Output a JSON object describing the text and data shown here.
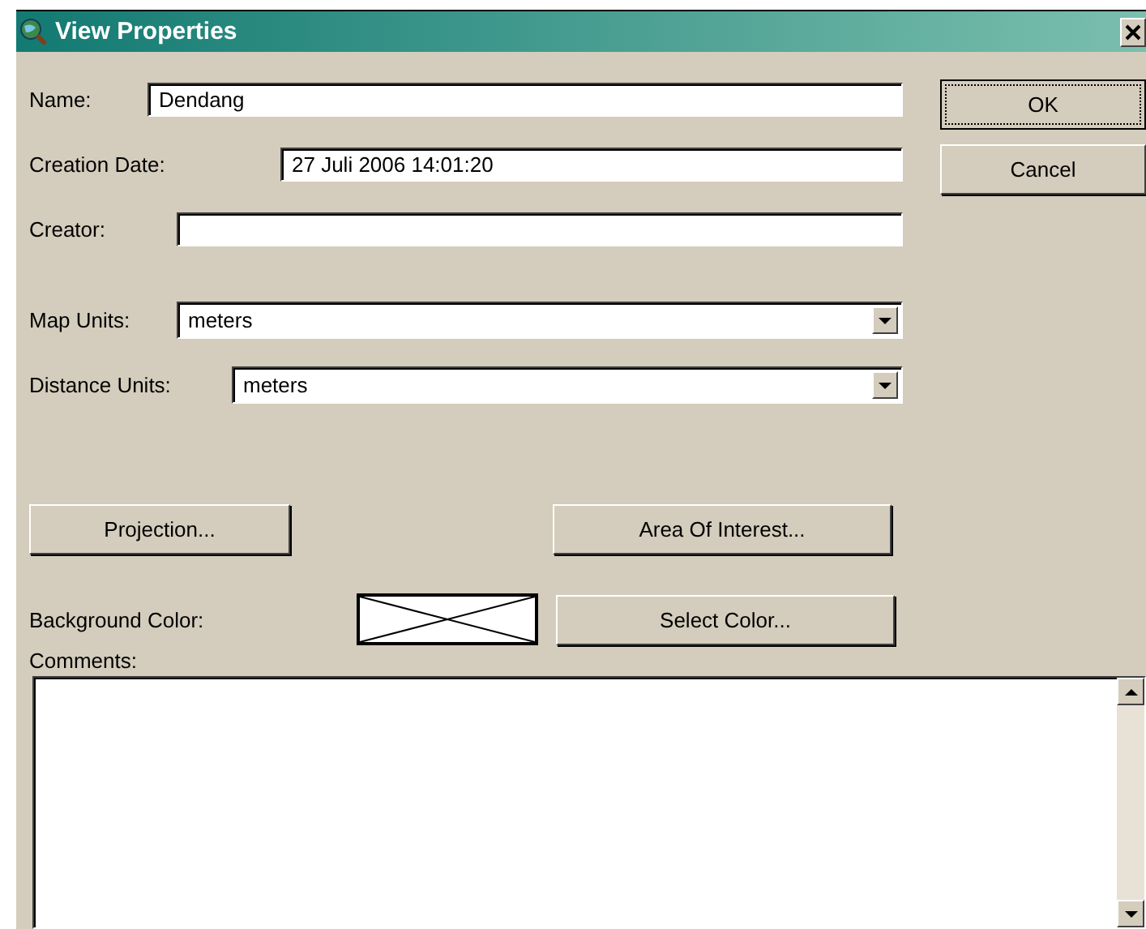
{
  "window": {
    "title": "View Properties"
  },
  "fields": [
    {
      "label": "Name:",
      "value": "Dendang",
      "kind": "text"
    },
    {
      "label": "Creation Date:",
      "value": "27 Juli 2006 14:01:20",
      "kind": "text"
    },
    {
      "label": "Creator:",
      "kind": "text"
    },
    {
      "label": "Map Units:",
      "value": "meters",
      "kind": "combo"
    },
    {
      "label": "Distance Units:",
      "value": "meters",
      "kind": "combo"
    }
  ],
  "side_buttons": [
    {
      "label": "OK",
      "focused": true
    },
    {
      "label": "Cancel",
      "focused": false
    }
  ],
  "projection_button": "Projection...",
  "area_button": "Area Of Interest...",
  "background_color": {
    "label": "Background Color:",
    "button": "Select Color..."
  },
  "comments": {
    "label": "Comments:"
  }
}
